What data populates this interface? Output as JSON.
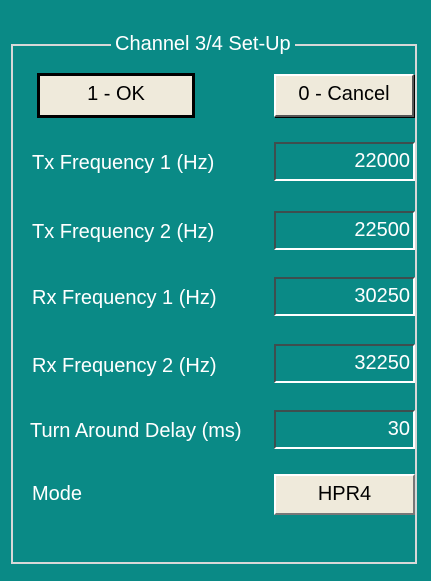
{
  "title": "Channel 3/4 Set-Up",
  "buttons": {
    "ok_label": "1 - OK",
    "cancel_label": "0 - Cancel"
  },
  "fields": [
    {
      "label": "Tx Frequency 1 (Hz)",
      "value": "22000"
    },
    {
      "label": "Tx Frequency 2 (Hz)",
      "value": "22500"
    },
    {
      "label": "Rx Frequency 1 (Hz)",
      "value": "30250"
    },
    {
      "label": "Rx Frequency 2 (Hz)",
      "value": "32250"
    },
    {
      "label": "Turn Around Delay (ms)",
      "value": "30"
    }
  ],
  "mode": {
    "label": "Mode",
    "value": "HPR4"
  },
  "colors": {
    "background": "#0a8a86",
    "button_face": "#efeadb",
    "text": "#ffffff"
  }
}
